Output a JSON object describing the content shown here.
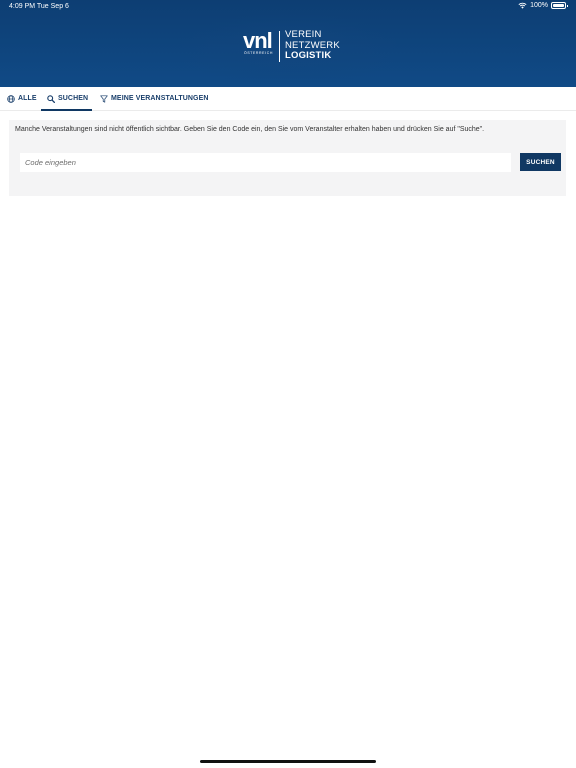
{
  "statusbar": {
    "time": "4:09 PM   Tue Sep 6",
    "battery": "100%"
  },
  "logo": {
    "mark": "vnl",
    "sub": "ÖSTERREICH",
    "line1": "VEREIN",
    "line2": "NETZWERK",
    "line3": "LOGISTIK"
  },
  "tabs": [
    {
      "label": "ALLE",
      "icon": "globe-icon"
    },
    {
      "label": "SUCHEN",
      "icon": "search-icon",
      "active": true
    },
    {
      "label": "MEINE VERANSTALTUNGEN",
      "icon": "filter-icon"
    }
  ],
  "search": {
    "info": "Manche Veranstaltungen sind nicht öffentlich sichtbar. Geben Sie den Code ein, den Sie vom Veranstalter erhalten haben und drücken Sie auf \"Suche\".",
    "placeholder": "Code eingeben",
    "value": "",
    "button_label": "SUCHEN"
  },
  "colors": {
    "header": "#0f4680",
    "accent": "#103863",
    "tab_text": "#1a3f6b",
    "panel_bg": "#f4f4f5"
  }
}
